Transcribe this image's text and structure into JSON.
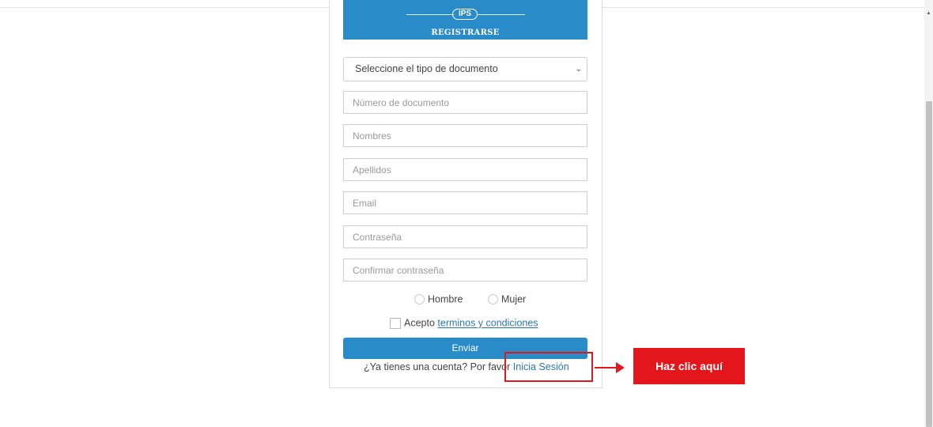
{
  "header": {
    "logo_badge": "IPS",
    "title": "REGISTRARSE"
  },
  "form": {
    "document_type_select": "Seleccione el tipo de documento",
    "fields": {
      "document_number": "Número de documento",
      "first_names": "Nombres",
      "last_names": "Apellidos",
      "email": "Email",
      "password": "Contraseña",
      "confirm_password": "Confirmar contraseña"
    },
    "gender": {
      "male": "Hombre",
      "female": "Mujer"
    },
    "terms": {
      "prefix": "Acepto",
      "link": "terminos y condiciones"
    },
    "submit": "Enviar",
    "login_prompt": {
      "text": "¿Ya tienes una cuenta? Por favor",
      "link": "Inicia Sesión"
    }
  },
  "annotation": {
    "callout": "Haz clic aquí",
    "color": "#e3161b"
  },
  "colors": {
    "brand_blue": "#2a8bc9"
  }
}
